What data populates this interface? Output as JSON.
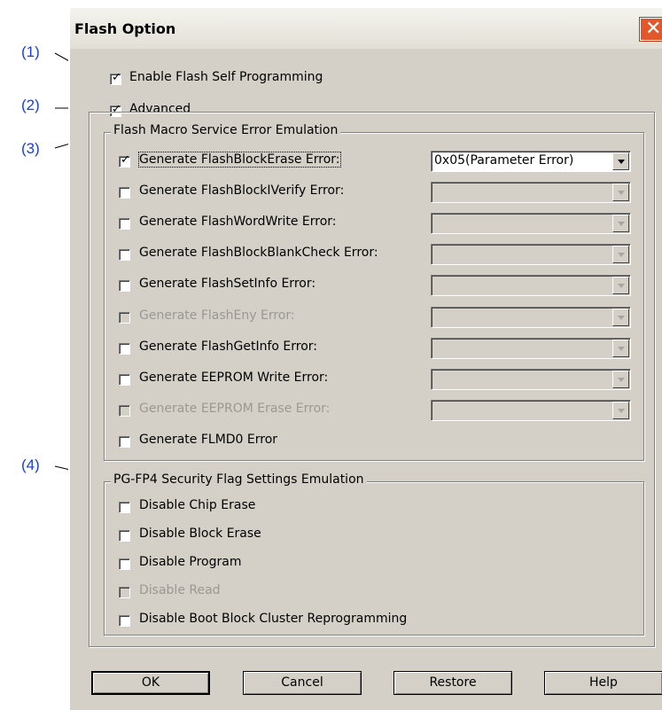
{
  "callouts": [
    "(1)",
    "(2)",
    "(3)",
    "(4)"
  ],
  "window": {
    "title": "Flash Option",
    "close_glyph": "✕"
  },
  "enable_self_programming": {
    "label": "Enable Flash Self Programming",
    "checked": true
  },
  "advanced": {
    "label": "Advanced",
    "checked": true
  },
  "fms_group": {
    "title": "Flash Macro Service Error Emulation",
    "rows": [
      {
        "label": "Generate FlashBlockErase Error:",
        "checked": true,
        "enabled": true,
        "combo": "0x05(Parameter Error)",
        "combo_enabled": true
      },
      {
        "label": "Generate FlashBlockIVerify Error:",
        "checked": false,
        "enabled": true,
        "combo": "",
        "combo_enabled": false
      },
      {
        "label": "Generate FlashWordWrite Error:",
        "checked": false,
        "enabled": true,
        "combo": "",
        "combo_enabled": false
      },
      {
        "label": "Generate FlashBlockBlankCheck Error:",
        "checked": false,
        "enabled": true,
        "combo": "",
        "combo_enabled": false
      },
      {
        "label": "Generate FlashSetInfo Error:",
        "checked": false,
        "enabled": true,
        "combo": "",
        "combo_enabled": false
      },
      {
        "label": "Generate FlashEny Error:",
        "checked": false,
        "enabled": false,
        "combo": "",
        "combo_enabled": false
      },
      {
        "label": "Generate FlashGetInfo Error:",
        "checked": false,
        "enabled": true,
        "combo": "",
        "combo_enabled": false
      },
      {
        "label": "Generate EEPROM Write Error:",
        "checked": false,
        "enabled": true,
        "combo": "",
        "combo_enabled": false
      },
      {
        "label": "Generate EEPROM Erase Error:",
        "checked": false,
        "enabled": false,
        "combo": "",
        "combo_enabled": false
      },
      {
        "label": "Generate FLMD0 Error",
        "checked": false,
        "enabled": true
      }
    ]
  },
  "security_group": {
    "title": "PG-FP4 Security Flag Settings Emulation",
    "rows": [
      {
        "label": "Disable Chip Erase",
        "checked": false,
        "enabled": true
      },
      {
        "label": "Disable Block Erase",
        "checked": false,
        "enabled": true
      },
      {
        "label": "Disable Program",
        "checked": false,
        "enabled": true
      },
      {
        "label": "Disable Read",
        "checked": false,
        "enabled": false
      },
      {
        "label": "Disable Boot Block Cluster Reprogramming",
        "checked": false,
        "enabled": true
      }
    ]
  },
  "buttons": {
    "ok": "OK",
    "cancel": "Cancel",
    "restore": "Restore",
    "help": "Help"
  },
  "colors": {
    "dialog_bg": "#d4d0c8",
    "callout_text": "#1a3fd6",
    "close_button": "#e2582a"
  }
}
